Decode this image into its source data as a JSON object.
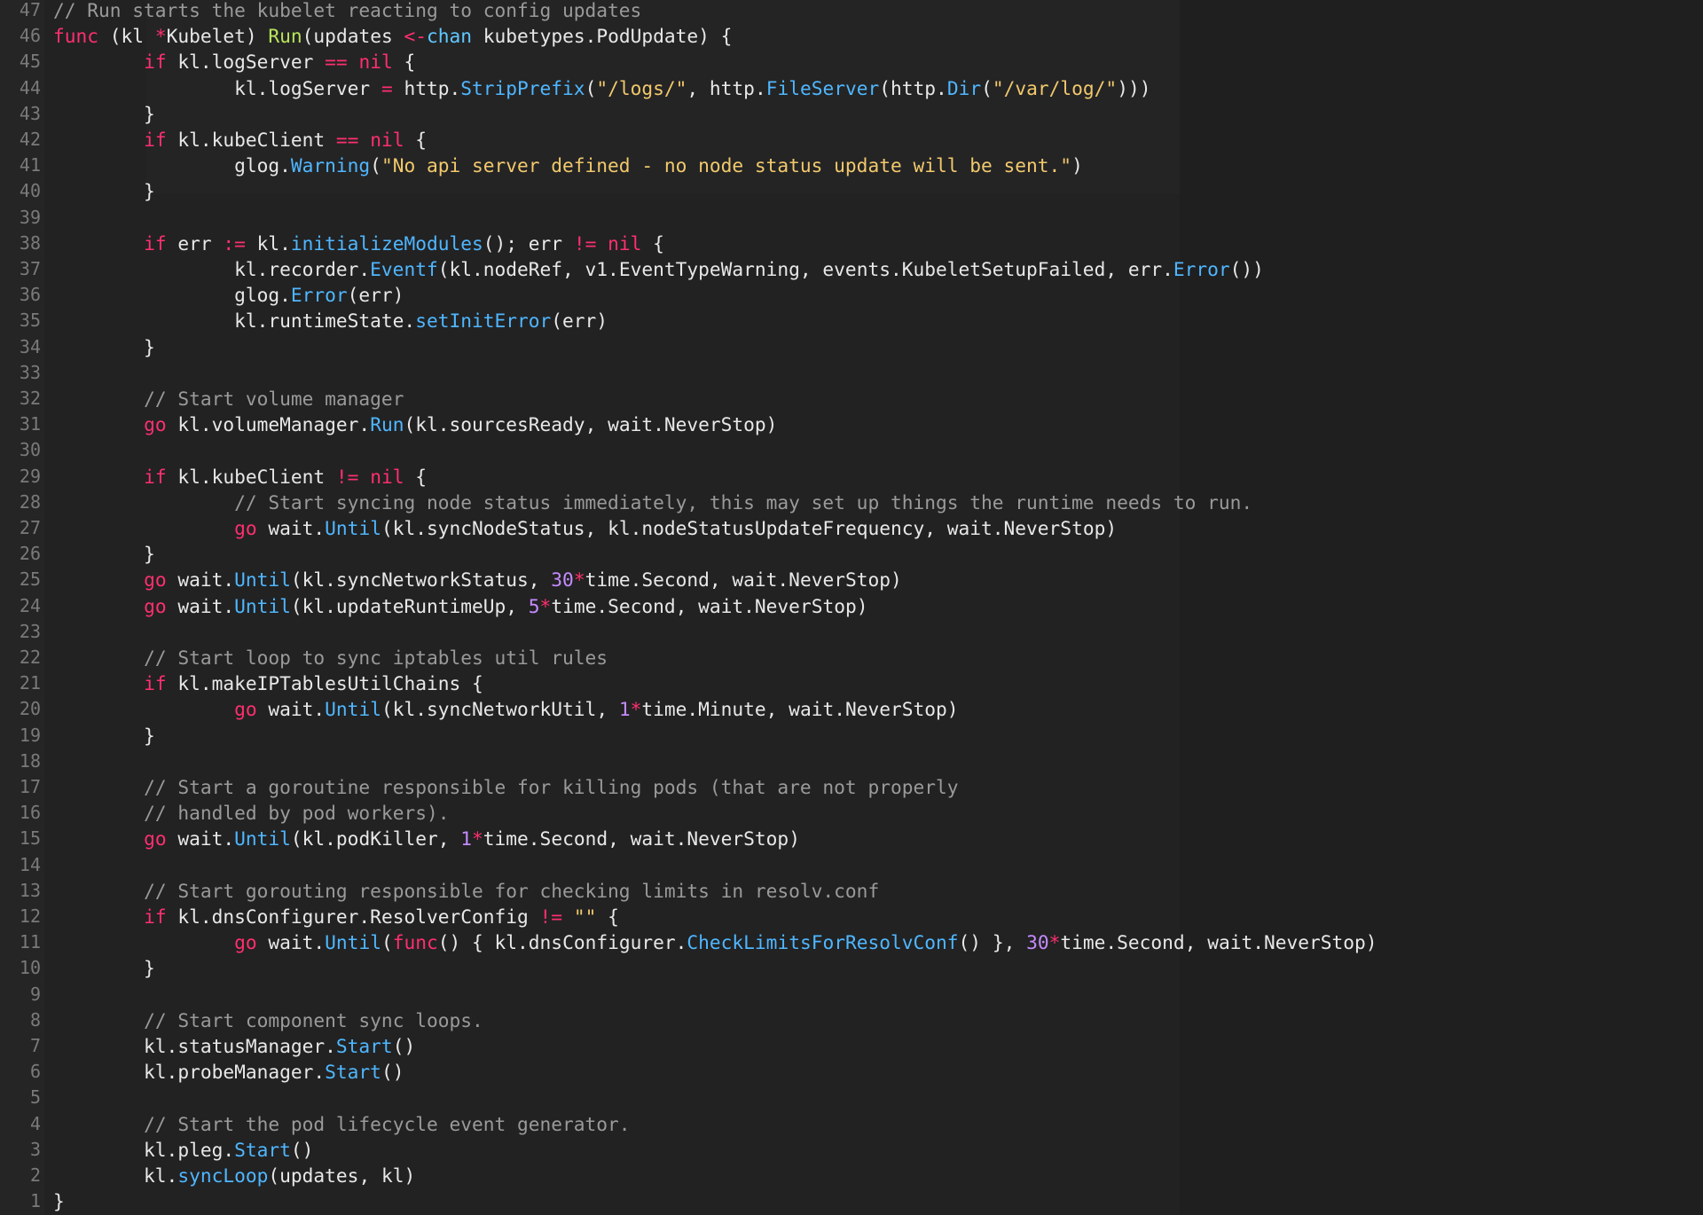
{
  "editor": {
    "language": "go",
    "colors": {
      "background": "#222223",
      "keyword": "#ff2f6e",
      "function": "#4fb7ff",
      "func_decl": "#b9e45b",
      "string": "#f2c96b",
      "comment": "#9a9a9a",
      "number": "#c58bff",
      "plain": "#e8e8e8",
      "line_number": "#7a7a7a"
    },
    "lines": [
      {
        "n": "47",
        "tokens": [
          [
            "cm",
            "// Run starts the kubelet reacting to config updates"
          ]
        ]
      },
      {
        "n": "46",
        "tokens": [
          [
            "kw",
            "func"
          ],
          [
            "pl",
            " (kl "
          ],
          [
            "op",
            "*"
          ],
          [
            "pl",
            "Kubelet) "
          ],
          [
            "fnd",
            "Run"
          ],
          [
            "pl",
            "(updates "
          ],
          [
            "op",
            "<-"
          ],
          [
            "ty",
            "chan"
          ],
          [
            "pl",
            " kubetypes.PodUpdate) {"
          ]
        ]
      },
      {
        "n": "45",
        "tokens": [
          [
            "pl",
            "        "
          ],
          [
            "kw",
            "if"
          ],
          [
            "pl",
            " kl.logServer "
          ],
          [
            "op",
            "=="
          ],
          [
            "pl",
            " "
          ],
          [
            "kw",
            "nil"
          ],
          [
            "pl",
            " {"
          ]
        ]
      },
      {
        "n": "44",
        "tokens": [
          [
            "pl",
            "                kl.logServer "
          ],
          [
            "op",
            "="
          ],
          [
            "pl",
            " http."
          ],
          [
            "fn",
            "StripPrefix"
          ],
          [
            "pl",
            "("
          ],
          [
            "str",
            "\"/logs/\""
          ],
          [
            "pl",
            ", http."
          ],
          [
            "fn",
            "FileServer"
          ],
          [
            "pl",
            "(http."
          ],
          [
            "fn",
            "Dir"
          ],
          [
            "pl",
            "("
          ],
          [
            "str",
            "\"/var/log/\""
          ],
          [
            "pl",
            ")))"
          ]
        ]
      },
      {
        "n": "43",
        "tokens": [
          [
            "pl",
            "        }"
          ]
        ]
      },
      {
        "n": "42",
        "tokens": [
          [
            "pl",
            "        "
          ],
          [
            "kw",
            "if"
          ],
          [
            "pl",
            " kl.kubeClient "
          ],
          [
            "op",
            "=="
          ],
          [
            "pl",
            " "
          ],
          [
            "kw",
            "nil"
          ],
          [
            "pl",
            " {"
          ]
        ]
      },
      {
        "n": "41",
        "tokens": [
          [
            "pl",
            "                glog."
          ],
          [
            "fn",
            "Warning"
          ],
          [
            "pl",
            "("
          ],
          [
            "str",
            "\"No api server defined - no node status update will be sent.\""
          ],
          [
            "pl",
            ")"
          ]
        ]
      },
      {
        "n": "40",
        "tokens": [
          [
            "pl",
            "        }"
          ]
        ]
      },
      {
        "n": "39",
        "tokens": []
      },
      {
        "n": "38",
        "tokens": [
          [
            "pl",
            "        "
          ],
          [
            "kw",
            "if"
          ],
          [
            "pl",
            " err "
          ],
          [
            "op",
            ":="
          ],
          [
            "pl",
            " kl."
          ],
          [
            "fn",
            "initializeModules"
          ],
          [
            "pl",
            "(); err "
          ],
          [
            "op",
            "!="
          ],
          [
            "pl",
            " "
          ],
          [
            "kw",
            "nil"
          ],
          [
            "pl",
            " {"
          ]
        ]
      },
      {
        "n": "37",
        "tokens": [
          [
            "pl",
            "                kl.recorder."
          ],
          [
            "fn",
            "Eventf"
          ],
          [
            "pl",
            "(kl.nodeRef, v1.EventTypeWarning, events.KubeletSetupFailed, err."
          ],
          [
            "fn",
            "Error"
          ],
          [
            "pl",
            "())"
          ]
        ]
      },
      {
        "n": "36",
        "tokens": [
          [
            "pl",
            "                glog."
          ],
          [
            "fn",
            "Error"
          ],
          [
            "pl",
            "(err)"
          ]
        ]
      },
      {
        "n": "35",
        "tokens": [
          [
            "pl",
            "                kl.runtimeState."
          ],
          [
            "fn",
            "setInitError"
          ],
          [
            "pl",
            "(err)"
          ]
        ]
      },
      {
        "n": "34",
        "tokens": [
          [
            "pl",
            "        }"
          ]
        ]
      },
      {
        "n": "33",
        "tokens": []
      },
      {
        "n": "32",
        "tokens": [
          [
            "pl",
            "        "
          ],
          [
            "cm",
            "// Start volume manager"
          ]
        ]
      },
      {
        "n": "31",
        "tokens": [
          [
            "pl",
            "        "
          ],
          [
            "kw",
            "go"
          ],
          [
            "pl",
            " kl.volumeManager."
          ],
          [
            "fn",
            "Run"
          ],
          [
            "pl",
            "(kl.sourcesReady, wait.NeverStop)"
          ]
        ]
      },
      {
        "n": "30",
        "tokens": []
      },
      {
        "n": "29",
        "tokens": [
          [
            "pl",
            "        "
          ],
          [
            "kw",
            "if"
          ],
          [
            "pl",
            " kl.kubeClient "
          ],
          [
            "op",
            "!="
          ],
          [
            "pl",
            " "
          ],
          [
            "kw",
            "nil"
          ],
          [
            "pl",
            " {"
          ]
        ]
      },
      {
        "n": "28",
        "tokens": [
          [
            "pl",
            "                "
          ],
          [
            "cm",
            "// Start syncing node status immediately, this may set up things the runtime needs to run."
          ]
        ]
      },
      {
        "n": "27",
        "tokens": [
          [
            "pl",
            "                "
          ],
          [
            "kw",
            "go"
          ],
          [
            "pl",
            " wait."
          ],
          [
            "fn",
            "Until"
          ],
          [
            "pl",
            "(kl.syncNodeStatus, kl.nodeStatusUpdateFrequency, wait.NeverStop)"
          ]
        ]
      },
      {
        "n": "26",
        "tokens": [
          [
            "pl",
            "        }"
          ]
        ]
      },
      {
        "n": "25",
        "tokens": [
          [
            "pl",
            "        "
          ],
          [
            "kw",
            "go"
          ],
          [
            "pl",
            " wait."
          ],
          [
            "fn",
            "Until"
          ],
          [
            "pl",
            "(kl.syncNetworkStatus, "
          ],
          [
            "num",
            "30"
          ],
          [
            "op",
            "*"
          ],
          [
            "pl",
            "time.Second, wait.NeverStop)"
          ]
        ]
      },
      {
        "n": "24",
        "tokens": [
          [
            "pl",
            "        "
          ],
          [
            "kw",
            "go"
          ],
          [
            "pl",
            " wait."
          ],
          [
            "fn",
            "Until"
          ],
          [
            "pl",
            "(kl.updateRuntimeUp, "
          ],
          [
            "num",
            "5"
          ],
          [
            "op",
            "*"
          ],
          [
            "pl",
            "time.Second, wait.NeverStop)"
          ]
        ]
      },
      {
        "n": "23",
        "tokens": []
      },
      {
        "n": "22",
        "tokens": [
          [
            "pl",
            "        "
          ],
          [
            "cm",
            "// Start loop to sync iptables util rules"
          ]
        ]
      },
      {
        "n": "21",
        "tokens": [
          [
            "pl",
            "        "
          ],
          [
            "kw",
            "if"
          ],
          [
            "pl",
            " kl.makeIPTablesUtilChains {"
          ]
        ]
      },
      {
        "n": "20",
        "tokens": [
          [
            "pl",
            "                "
          ],
          [
            "kw",
            "go"
          ],
          [
            "pl",
            " wait."
          ],
          [
            "fn",
            "Until"
          ],
          [
            "pl",
            "(kl.syncNetworkUtil, "
          ],
          [
            "num",
            "1"
          ],
          [
            "op",
            "*"
          ],
          [
            "pl",
            "time.Minute, wait.NeverStop)"
          ]
        ]
      },
      {
        "n": "19",
        "tokens": [
          [
            "pl",
            "        }"
          ]
        ]
      },
      {
        "n": "18",
        "tokens": []
      },
      {
        "n": "17",
        "tokens": [
          [
            "pl",
            "        "
          ],
          [
            "cm",
            "// Start a goroutine responsible for killing pods (that are not properly"
          ]
        ]
      },
      {
        "n": "16",
        "tokens": [
          [
            "pl",
            "        "
          ],
          [
            "cm",
            "// handled by pod workers)."
          ]
        ]
      },
      {
        "n": "15",
        "tokens": [
          [
            "pl",
            "        "
          ],
          [
            "kw",
            "go"
          ],
          [
            "pl",
            " wait."
          ],
          [
            "fn",
            "Until"
          ],
          [
            "pl",
            "(kl.podKiller, "
          ],
          [
            "num",
            "1"
          ],
          [
            "op",
            "*"
          ],
          [
            "pl",
            "time.Second, wait.NeverStop)"
          ]
        ]
      },
      {
        "n": "14",
        "tokens": []
      },
      {
        "n": "13",
        "tokens": [
          [
            "pl",
            "        "
          ],
          [
            "cm",
            "// Start gorouting responsible for checking limits in resolv.conf"
          ]
        ]
      },
      {
        "n": "12",
        "tokens": [
          [
            "pl",
            "        "
          ],
          [
            "kw",
            "if"
          ],
          [
            "pl",
            " kl.dnsConfigurer.ResolverConfig "
          ],
          [
            "op",
            "!="
          ],
          [
            "pl",
            " "
          ],
          [
            "str",
            "\"\""
          ],
          [
            "pl",
            " {"
          ]
        ]
      },
      {
        "n": "11",
        "tokens": [
          [
            "pl",
            "                "
          ],
          [
            "kw",
            "go"
          ],
          [
            "pl",
            " wait."
          ],
          [
            "fn",
            "Until"
          ],
          [
            "pl",
            "("
          ],
          [
            "kw",
            "func"
          ],
          [
            "pl",
            "() { kl.dnsConfigurer."
          ],
          [
            "fn",
            "CheckLimitsForResolvConf"
          ],
          [
            "pl",
            "() }, "
          ],
          [
            "num",
            "30"
          ],
          [
            "op",
            "*"
          ],
          [
            "pl",
            "time.Second, wait.NeverStop)"
          ]
        ]
      },
      {
        "n": "10",
        "tokens": [
          [
            "pl",
            "        }"
          ]
        ]
      },
      {
        "n": "9",
        "tokens": []
      },
      {
        "n": "8",
        "tokens": [
          [
            "pl",
            "        "
          ],
          [
            "cm",
            "// Start component sync loops."
          ]
        ]
      },
      {
        "n": "7",
        "tokens": [
          [
            "pl",
            "        kl.statusManager."
          ],
          [
            "fn",
            "Start"
          ],
          [
            "pl",
            "()"
          ]
        ]
      },
      {
        "n": "6",
        "tokens": [
          [
            "pl",
            "        kl.probeManager."
          ],
          [
            "fn",
            "Start"
          ],
          [
            "pl",
            "()"
          ]
        ]
      },
      {
        "n": "5",
        "tokens": []
      },
      {
        "n": "4",
        "tokens": [
          [
            "pl",
            "        "
          ],
          [
            "cm",
            "// Start the pod lifecycle event generator."
          ]
        ]
      },
      {
        "n": "3",
        "tokens": [
          [
            "pl",
            "        kl.pleg."
          ],
          [
            "fn",
            "Start"
          ],
          [
            "pl",
            "()"
          ]
        ]
      },
      {
        "n": "2",
        "tokens": [
          [
            "pl",
            "        kl."
          ],
          [
            "fn",
            "syncLoop"
          ],
          [
            "pl",
            "(updates, kl)"
          ]
        ]
      },
      {
        "n": "1",
        "tokens": [
          [
            "pl",
            "}"
          ]
        ]
      }
    ]
  }
}
